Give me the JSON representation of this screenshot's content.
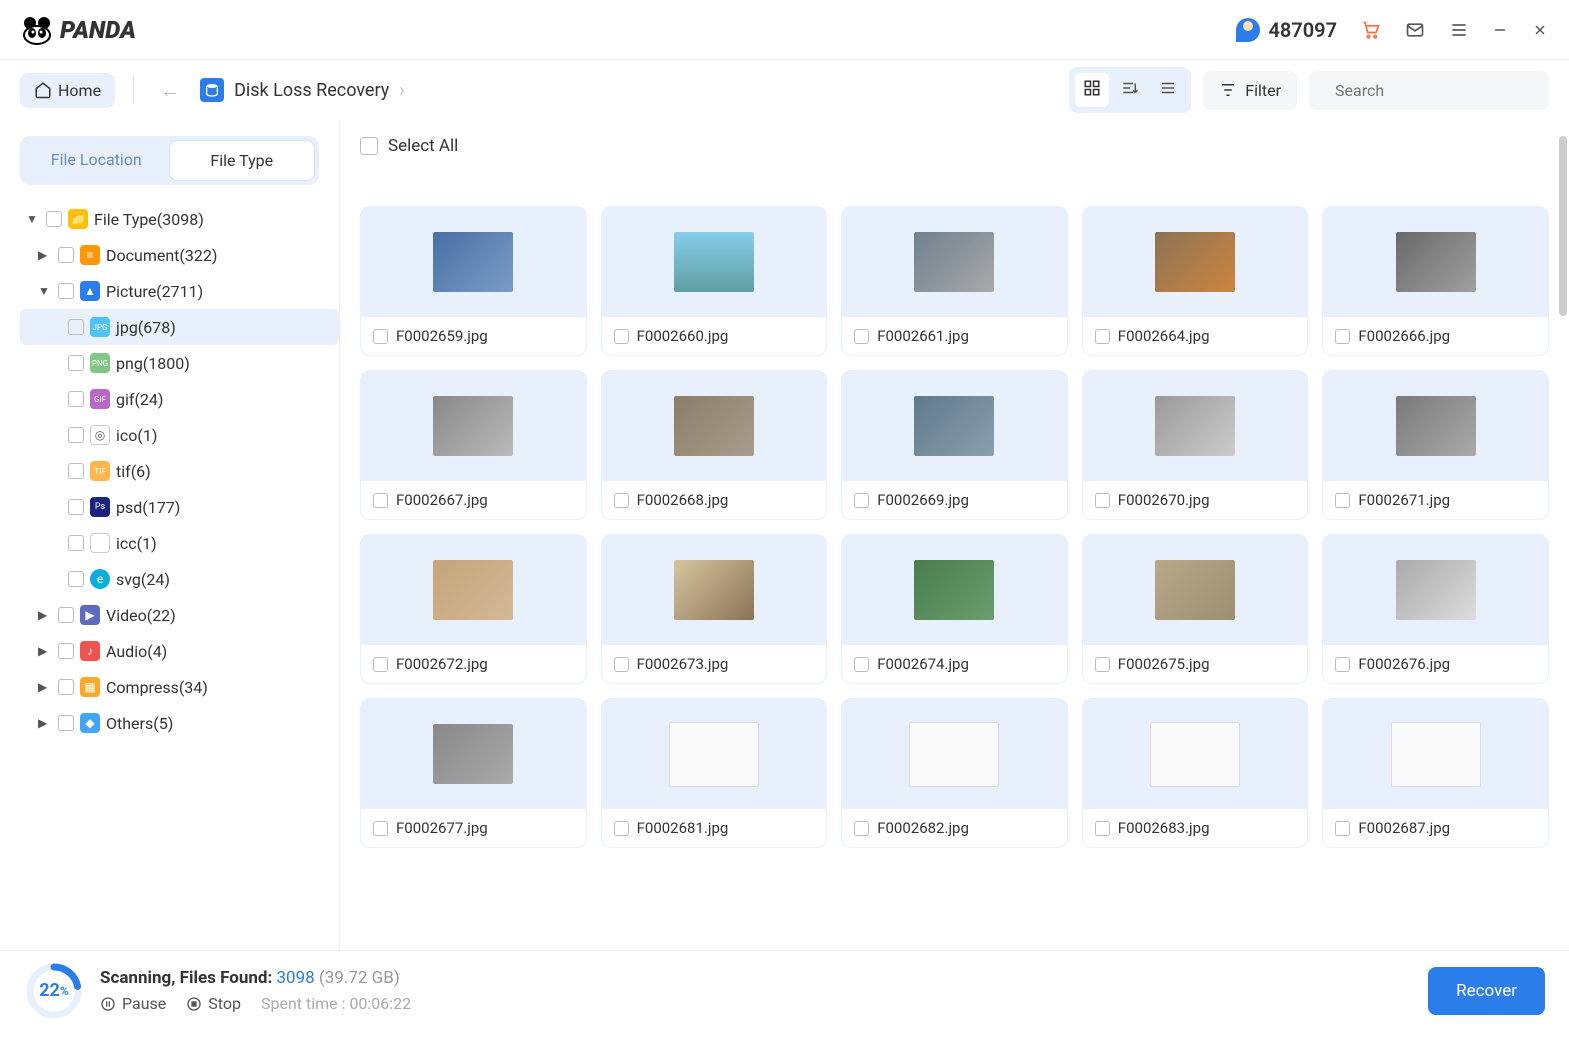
{
  "app": {
    "name": "PANDA",
    "user_badge": "487097"
  },
  "toolbar": {
    "home": "Home",
    "breadcrumb": "Disk Loss Recovery",
    "filter": "Filter",
    "search_placeholder": "Search"
  },
  "sidebar": {
    "tabs": {
      "location": "File Location",
      "type": "File Type"
    },
    "tree": {
      "root": "File Type(3098)",
      "document": "Document(322)",
      "picture": "Picture(2711)",
      "jpg": "jpg(678)",
      "png": "png(1800)",
      "gif": "gif(24)",
      "ico": "ico(1)",
      "tif": "tif(6)",
      "psd": "psd(177)",
      "icc": "icc(1)",
      "svg": "svg(24)",
      "video": "Video(22)",
      "audio": "Audio(4)",
      "compress": "Compress(34)",
      "others": "Others(5)"
    }
  },
  "content": {
    "select_all": "Select All",
    "files": [
      "F0002659.jpg",
      "F0002660.jpg",
      "F0002661.jpg",
      "F0002664.jpg",
      "F0002666.jpg",
      "F0002667.jpg",
      "F0002668.jpg",
      "F0002669.jpg",
      "F0002670.jpg",
      "F0002671.jpg",
      "F0002672.jpg",
      "F0002673.jpg",
      "F0002674.jpg",
      "F0002675.jpg",
      "F0002676.jpg",
      "F0002677.jpg",
      "F0002681.jpg",
      "F0002682.jpg",
      "F0002683.jpg",
      "F0002687.jpg"
    ]
  },
  "status": {
    "percent": "22",
    "percent_unit": "%",
    "label": "Scanning, Files Found:",
    "count": "3098",
    "size": "(39.72 GB)",
    "pause": "Pause",
    "stop": "Stop",
    "spent_label": "Spent time : ",
    "spent_time": "00:06:22",
    "recover": "Recover"
  }
}
